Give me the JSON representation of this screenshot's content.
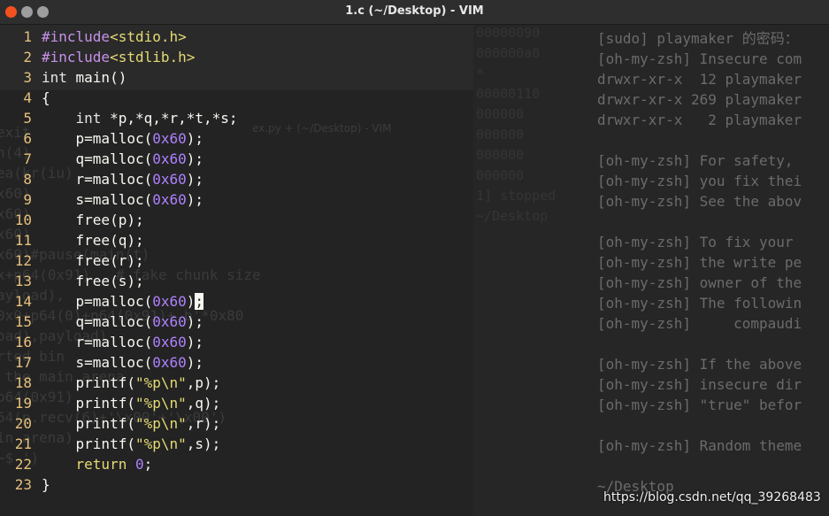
{
  "window": {
    "title": "1.c (~/Desktop) - VIM",
    "ghost_title": "ex.py + (~/Desktop) - VIM"
  },
  "editor": {
    "lines": [
      {
        "n": "1",
        "tokens": [
          [
            "pre",
            "#include"
          ],
          [
            "str",
            "<stdio.h>"
          ]
        ]
      },
      {
        "n": "2",
        "tokens": [
          [
            "pre",
            "#include"
          ],
          [
            "str",
            "<stdlib.h>"
          ]
        ]
      },
      {
        "n": "3",
        "tokens": [
          [
            "type",
            "int "
          ],
          [
            "txt",
            "main()"
          ]
        ]
      },
      {
        "n": "4",
        "tokens": [
          [
            "txt",
            "{"
          ]
        ]
      },
      {
        "n": "5",
        "tokens": [
          [
            "txt",
            "    "
          ],
          [
            "type",
            "int "
          ],
          [
            "txt",
            "*p,*q,*r,*t,*s;"
          ]
        ]
      },
      {
        "n": "6",
        "tokens": [
          [
            "txt",
            "    p=malloc("
          ],
          [
            "num",
            "0x60"
          ],
          [
            "txt",
            ");"
          ]
        ]
      },
      {
        "n": "7",
        "tokens": [
          [
            "txt",
            "    q=malloc("
          ],
          [
            "num",
            "0x60"
          ],
          [
            "txt",
            ");"
          ]
        ]
      },
      {
        "n": "8",
        "tokens": [
          [
            "txt",
            "    r=malloc("
          ],
          [
            "num",
            "0x60"
          ],
          [
            "txt",
            ");"
          ]
        ]
      },
      {
        "n": "9",
        "tokens": [
          [
            "txt",
            "    s=malloc("
          ],
          [
            "num",
            "0x60"
          ],
          [
            "txt",
            ");"
          ]
        ]
      },
      {
        "n": "10",
        "tokens": [
          [
            "txt",
            "    free(p);"
          ]
        ]
      },
      {
        "n": "11",
        "tokens": [
          [
            "txt",
            "    free(q);"
          ]
        ]
      },
      {
        "n": "12",
        "tokens": [
          [
            "txt",
            "    free(r);"
          ]
        ]
      },
      {
        "n": "13",
        "tokens": [
          [
            "txt",
            "    free(s);"
          ]
        ]
      },
      {
        "n": "14",
        "tokens": [
          [
            "txt",
            "    p=malloc("
          ],
          [
            "num",
            "0x60"
          ],
          [
            "txt",
            ")"
          ],
          [
            "cursor",
            ";"
          ]
        ]
      },
      {
        "n": "15",
        "tokens": [
          [
            "txt",
            "    q=malloc("
          ],
          [
            "num",
            "0x60"
          ],
          [
            "txt",
            ");"
          ]
        ]
      },
      {
        "n": "16",
        "tokens": [
          [
            "txt",
            "    r=malloc("
          ],
          [
            "num",
            "0x60"
          ],
          [
            "txt",
            ");"
          ]
        ]
      },
      {
        "n": "17",
        "tokens": [
          [
            "txt",
            "    s=malloc("
          ],
          [
            "num",
            "0x60"
          ],
          [
            "txt",
            ");"
          ]
        ]
      },
      {
        "n": "18",
        "tokens": [
          [
            "txt",
            "    printf("
          ],
          [
            "str",
            "\"%p\\n\""
          ],
          [
            "txt",
            ",p);"
          ]
        ]
      },
      {
        "n": "19",
        "tokens": [
          [
            "txt",
            "    printf("
          ],
          [
            "str",
            "\"%p\\n\""
          ],
          [
            "txt",
            ",q);"
          ]
        ]
      },
      {
        "n": "20",
        "tokens": [
          [
            "txt",
            "    printf("
          ],
          [
            "str",
            "\"%p\\n\""
          ],
          [
            "txt",
            ",r);"
          ]
        ]
      },
      {
        "n": "21",
        "tokens": [
          [
            "txt",
            "    printf("
          ],
          [
            "str",
            "\"%p\\n\""
          ],
          [
            "txt",
            ",s);"
          ]
        ]
      },
      {
        "n": "22",
        "tokens": [
          [
            "txt",
            "    "
          ],
          [
            "kw",
            "return "
          ],
          [
            "num",
            "0"
          ],
          [
            "txt",
            ";"
          ]
        ]
      },
      {
        "n": "23",
        "tokens": [
          [
            "txt",
            "}"
          ]
        ]
      }
    ]
  },
  "ghost_left": [
    "exit",
    "n(4)",
    "ea(kr(iu)",
    "",
    "x60)",
    "x60)",
    "x60)",
    "x60)#pause(main(t)",
    "x+p64(0x91)   # fake chunk size",
    "ayload),",
    "",
    "0x0+p64(0)+p64(0x91)+ b'*0x80",
    "oad),payload)",
    "rted bin",
    " the main arena",
    "p64(0x91)",
    "64(p.recv(6)+'\\x00'+'\\x00')",
    "in arena)",
    "~$ ')"
  ],
  "ghost_mid": [
    "00000090",
    "000000a0",
    "*",
    "00000110",
    "",
    "",
    "000000",
    "000000",
    "000000",
    "000000",
    "1] stopped",
    "",
    "~/Desktop"
  ],
  "terminal": {
    "lines": [
      "[sudo] playmaker 的密码：",
      "[oh-my-zsh] Insecure com",
      "drwxr-xr-x  12 playmaker",
      "drwxr-xr-x 269 playmaker",
      "drwxr-xr-x   2 playmaker",
      "",
      "[oh-my-zsh] For safety,",
      "[oh-my-zsh] you fix thei",
      "[oh-my-zsh] See the abov",
      "",
      "[oh-my-zsh] To fix your",
      "[oh-my-zsh] the write pe",
      "[oh-my-zsh] owner of the",
      "[oh-my-zsh] The followin",
      "[oh-my-zsh]     compaudi",
      "",
      "[oh-my-zsh] If the above",
      "[oh-my-zsh] insecure dir",
      "[oh-my-zsh] \"true\" befor",
      "",
      "[oh-my-zsh] Random theme",
      "",
      "~/Desktop"
    ]
  },
  "watermark": "https://blog.csdn.net/qq_39268483",
  "colors": {
    "keyword": "#e6db74",
    "preprocessor": "#c792ea",
    "number": "#ae81ff",
    "line_number": "#e5c07b",
    "text": "#f8f8f2",
    "background": "#232323"
  }
}
